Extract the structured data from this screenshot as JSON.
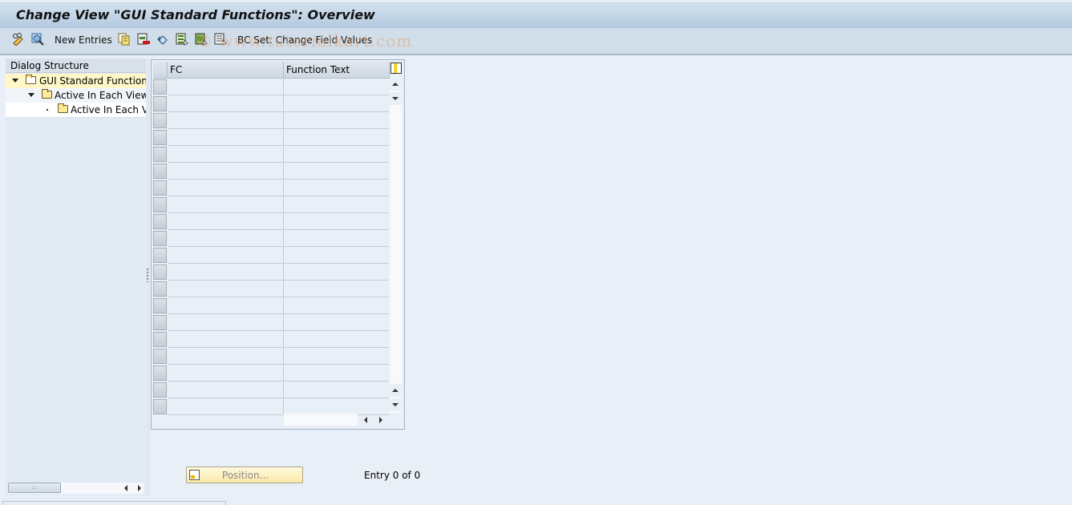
{
  "window": {
    "title": "Change View \"GUI Standard Functions\": Overview"
  },
  "toolbar": {
    "new_entries_label": "New Entries",
    "bc_set_label": "BC Set: Change Field Values",
    "icons": [
      "display-change-icon",
      "where-used-icon",
      "copy-icon",
      "delete-icon",
      "undo-icon",
      "select-all-icon",
      "select-block-icon",
      "deselect-all-icon"
    ]
  },
  "watermark": "© www.tutorialkart.com",
  "dialog_structure": {
    "header": "Dialog Structure",
    "items": [
      {
        "label": "GUI Standard Functions",
        "level": 0,
        "expanded": true,
        "selected": true
      },
      {
        "label": "Active In Each View",
        "level": 1,
        "expanded": true,
        "selected": false
      },
      {
        "label": "Active In Each Vi",
        "level": 2,
        "expanded": false,
        "selected": false
      }
    ]
  },
  "table": {
    "columns": [
      "FC",
      "Function Text"
    ],
    "row_count_visible": 20,
    "rows": []
  },
  "footer": {
    "position_button_label": "Position...",
    "entry_text": "Entry 0 of 0"
  }
}
